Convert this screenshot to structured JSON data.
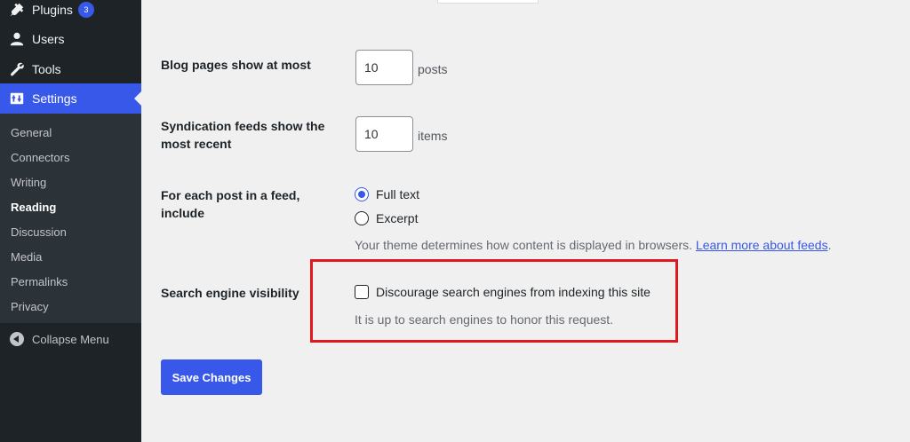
{
  "sidebar": {
    "menu": [
      {
        "label": "Plugins",
        "icon": "plugin-icon",
        "badge": "3"
      },
      {
        "label": "Users",
        "icon": "users-icon"
      },
      {
        "label": "Tools",
        "icon": "wrench-icon"
      },
      {
        "label": "Settings",
        "icon": "settings-icon"
      }
    ],
    "submenu": [
      "General",
      "Connectors",
      "Writing",
      "Reading",
      "Discussion",
      "Media",
      "Permalinks",
      "Privacy"
    ],
    "collapse_label": "Collapse Menu"
  },
  "reading": {
    "blog_pages": {
      "label": "Blog pages show at most",
      "value": "10",
      "unit": "posts"
    },
    "syndication": {
      "label": "Syndication feeds show the most recent",
      "value": "10",
      "unit": "items"
    },
    "feed_content": {
      "label": "For each post in a feed, include",
      "options": [
        "Full text",
        "Excerpt"
      ],
      "selected": "Full text",
      "description": "Your theme determines how content is displayed in browsers.",
      "link_text": "Learn more about feeds",
      "link_suffix": "."
    },
    "search_visibility": {
      "label": "Search engine visibility",
      "checkbox_label": "Discourage search engines from indexing this site",
      "checked": false,
      "description": "It is up to search engines to honor this request."
    },
    "save_label": "Save Changes"
  },
  "colors": {
    "accent": "#3858e9",
    "sidebar_bg": "#1d2327",
    "highlight": "#e0171f"
  }
}
